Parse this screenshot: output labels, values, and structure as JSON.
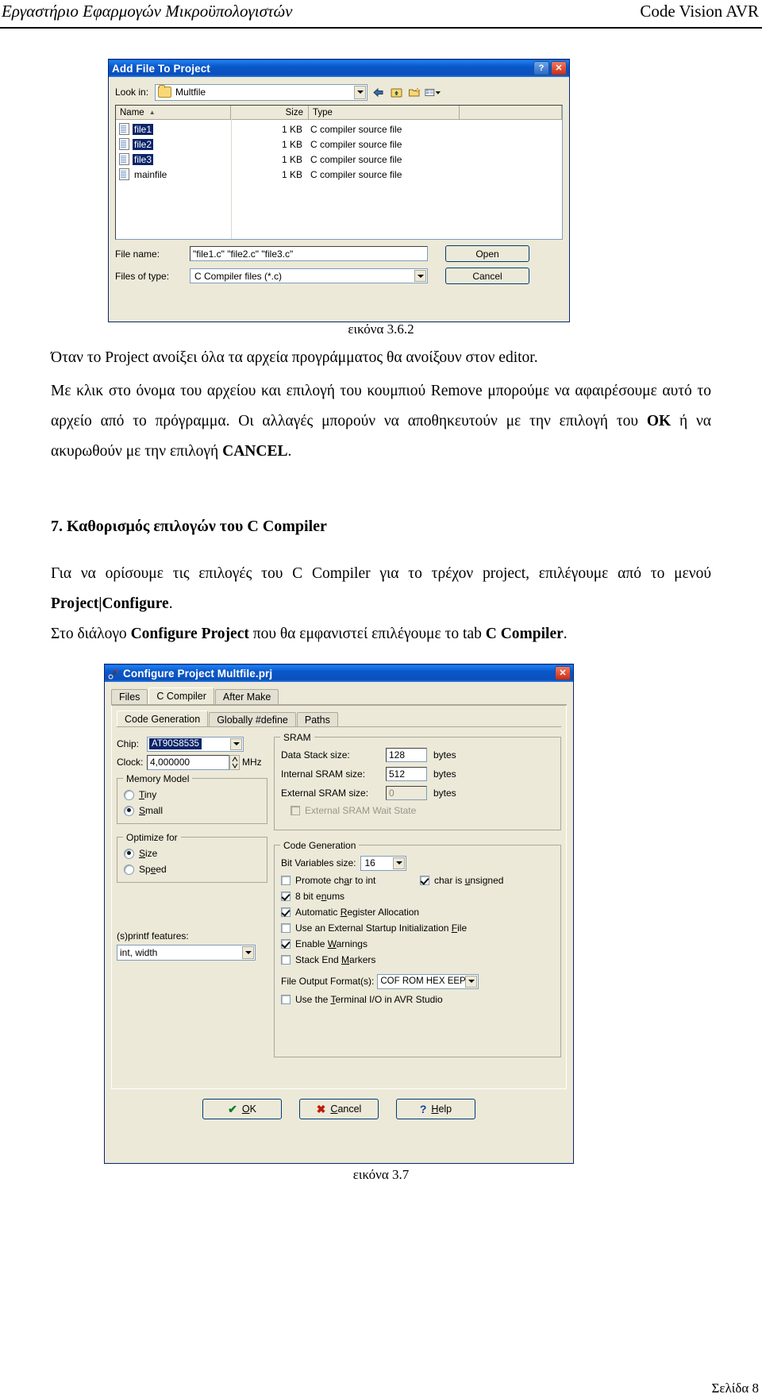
{
  "header": {
    "left": "Εργαστήριο Εφαρμογών Μικροϋπολογιστών",
    "right": "Code Vision AVR"
  },
  "footer": {
    "page": "Σελίδα 8"
  },
  "figure_captions": {
    "fig1": "εικόνα 3.6.2",
    "fig2": "εικόνα 3.7"
  },
  "body": {
    "p1": "Όταν το Project ανοίξει όλα τα αρχεία προγράμματος θα ανοίξουν στον editor.",
    "p2_a": "Με κλικ στο όνομα του αρχείου και επιλογή του κουμπιού Remove μπορούμε να αφαιρέσουμε αυτό το αρχείο από το πρόγραμμα. Οι αλλαγές μπορούν να αποθηκευτούν με την επιλογή του ",
    "p2_ok": "OK",
    "p2_b": " ή να ακυρωθούν με την επιλογή ",
    "p2_cancel": "CANCEL",
    "p2_c": ".",
    "section_num": "7.",
    "section_title": "Καθορισμός επιλογών του C Compiler",
    "p3": "Για να ορίσουμε τις επιλογές του C Compiler για το τρέχον project, επιλέγουμε από το μενού ",
    "p3_menu": "Project|Configure",
    "p3_end": ".",
    "p4_a": "Στο διάλογο ",
    "p4_dlg": "Configure Project",
    "p4_b": " που θα εμφανιστεί επιλέγουμε το tab ",
    "p4_tab": "C Compiler",
    "p4_c": "."
  },
  "dialog_addfile": {
    "title": "Add File To Project",
    "help_btn": "?",
    "close_btn": "✕",
    "lookin_label": "Look in:",
    "lookin_value": "Multfile",
    "toolbar_icons": [
      "back-icon",
      "up-one-level-icon",
      "new-folder-icon",
      "views-icon"
    ],
    "columns": [
      "Name",
      "Size",
      "Type"
    ],
    "sort_indicator": "▲",
    "files": [
      {
        "name": "file1",
        "size": "1 KB",
        "type": "C compiler source file",
        "selected": true
      },
      {
        "name": "file2",
        "size": "1 KB",
        "type": "C compiler source file",
        "selected": true
      },
      {
        "name": "file3",
        "size": "1 KB",
        "type": "C compiler source file",
        "selected": true
      },
      {
        "name": "mainfile",
        "size": "1 KB",
        "type": "C compiler source file",
        "selected": false
      }
    ],
    "filename_label": "File name:",
    "filename_value": "\"file1.c\" \"file2.c\" \"file3.c\"",
    "filetype_label": "Files of type:",
    "filetype_value": "C Compiler files (*.c)",
    "open_btn": "Open",
    "cancel_btn": "Cancel"
  },
  "dialog_config": {
    "title": "Configure Project Multfile.prj",
    "close_btn": "✕",
    "tabs": [
      {
        "label": "Files",
        "active": false
      },
      {
        "label": "C Compiler",
        "active": true
      },
      {
        "label": "After Make",
        "active": false
      }
    ],
    "subtabs": [
      {
        "label": "Code Generation",
        "active": true
      },
      {
        "label": "Globally #define",
        "active": false
      },
      {
        "label": "Paths",
        "active": false
      }
    ],
    "chip_label": "Chip:",
    "chip_value": "AT90S8535",
    "clock_label": "Clock:",
    "clock_value": "4,000000",
    "clock_unit": "MHz",
    "memory_model": {
      "title": "Memory Model",
      "options": [
        {
          "label": "Tiny",
          "selected": false
        },
        {
          "label": "Small",
          "selected": true
        }
      ]
    },
    "optimize": {
      "title": "Optimize for",
      "options": [
        {
          "label": "Size",
          "selected": true
        },
        {
          "label": "Speed",
          "selected": false
        }
      ]
    },
    "printf_label": "(s)printf features:",
    "printf_value": "int, width",
    "sram": {
      "title": "SRAM",
      "rows": [
        {
          "label": "Data Stack size:",
          "value": "128",
          "unit": "bytes",
          "disabled": false
        },
        {
          "label": "Internal SRAM size:",
          "value": "512",
          "unit": "bytes",
          "disabled": false
        },
        {
          "label": "External SRAM size:",
          "value": "0",
          "unit": "bytes",
          "disabled": true
        }
      ],
      "wait_state": {
        "label": "External SRAM Wait State",
        "checked": false,
        "disabled": true
      }
    },
    "codegen": {
      "title": "Code Generation",
      "bitvar_label": "Bit Variables size:",
      "bitvar_value": "16",
      "checks_row1": [
        {
          "label": "Promote char to int",
          "checked": false
        },
        {
          "label": "char is unsigned",
          "checked": true
        }
      ],
      "checks": [
        {
          "label": "8 bit enums",
          "checked": true
        },
        {
          "label": "Automatic Register Allocation",
          "checked": true
        },
        {
          "label": "Use an External Startup Initialization File",
          "checked": false
        },
        {
          "label": "Enable Warnings",
          "checked": true
        },
        {
          "label": "Stack End Markers",
          "checked": false
        }
      ],
      "fileout_label": "File Output Format(s):",
      "fileout_value": "COF ROM HEX EEP",
      "terminal": {
        "label": "Use the Terminal I/O in AVR Studio",
        "checked": false
      }
    },
    "buttons": [
      {
        "label": "OK",
        "icon": "check-icon"
      },
      {
        "label": "Cancel",
        "icon": "cross-icon"
      },
      {
        "label": "Help",
        "icon": "question-icon"
      }
    ]
  }
}
